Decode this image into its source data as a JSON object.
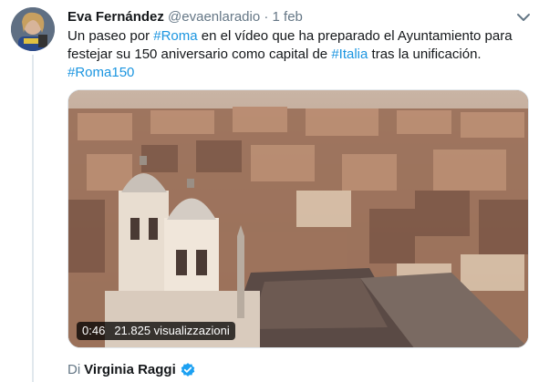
{
  "tweet": {
    "author_name": "Eva Fernández",
    "author_handle": "@evaenlaradio",
    "separator": "·",
    "date": "1 feb",
    "text_parts": [
      {
        "text": "Un paseo por ",
        "type": "plain"
      },
      {
        "text": "#Roma",
        "type": "hashtag"
      },
      {
        "text": " en el vídeo que ha preparado el Ayuntamiento para festejar su 150 aniversario como capital de ",
        "type": "plain"
      },
      {
        "text": "#Italia",
        "type": "hashtag"
      },
      {
        "text": " tras la unificación.",
        "type": "plain"
      }
    ],
    "hashtag_line": "#Roma150"
  },
  "video": {
    "duration": "0:46",
    "views": "21.825 visualizzazioni"
  },
  "attribution": {
    "prefix": "Di",
    "name": "Virginia Raggi"
  },
  "colors": {
    "link": "#1b95e0",
    "secondary_text": "#657786",
    "verified": "#1da1f2"
  },
  "icons": {
    "menu": "chevron-down-icon",
    "verified": "verified-badge-icon"
  }
}
